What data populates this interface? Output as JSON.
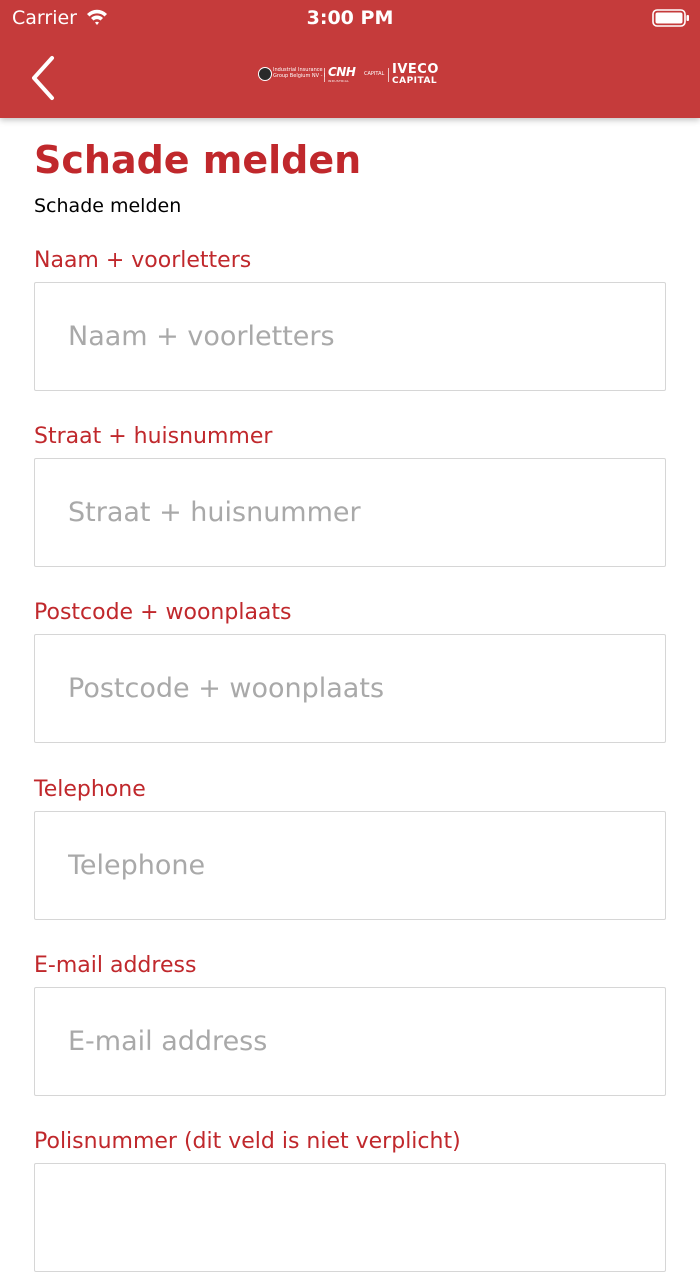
{
  "status_bar": {
    "carrier": "Carrier",
    "time": "3:00 PM"
  },
  "nav": {
    "back_icon": "chevron-left-icon",
    "logo": {
      "insurance_text": "Industrial Insurance Group Belgium NV - l",
      "cnh": "CNH",
      "industrial": "INDUSTRIAL",
      "capital_small": "CAPITAL",
      "iveco": "IVECO",
      "capital": "CAPITAL"
    }
  },
  "page": {
    "title": "Schade melden",
    "subtitle": "Schade melden"
  },
  "fields": [
    {
      "label": "Naam + voorletters",
      "placeholder": "Naam + voorletters",
      "value": ""
    },
    {
      "label": "Straat + huisnummer",
      "placeholder": "Straat + huisnummer",
      "value": ""
    },
    {
      "label": "Postcode + woonplaats",
      "placeholder": "Postcode + woonplaats",
      "value": ""
    },
    {
      "label": "Telephone",
      "placeholder": "Telephone",
      "value": ""
    },
    {
      "label": "E-mail address",
      "placeholder": "E-mail address",
      "value": ""
    },
    {
      "label": "Polisnummer (dit veld is niet verplicht)",
      "placeholder": "",
      "value": ""
    }
  ],
  "colors": {
    "header": "#c53b3b",
    "accent": "#c0282c",
    "input_border": "#d6d6d6",
    "placeholder": "#a9a9a9"
  }
}
